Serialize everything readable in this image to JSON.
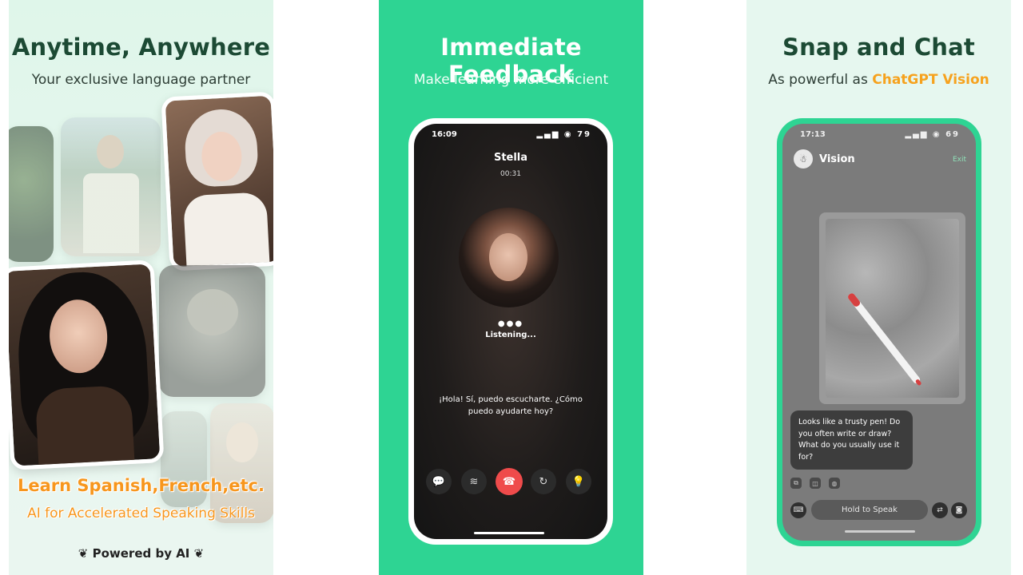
{
  "panel1": {
    "title": "Anytime, Anywhere",
    "subtitle": "Your exclusive language partner",
    "promo_line1": "Learn Spanish,French,etc.",
    "promo_line2": "AI for Accelerated Speaking Skills",
    "powered": "Powered by AI",
    "laurel_left": "❦",
    "laurel_right": "❦"
  },
  "panel2": {
    "title": "Immediate Feedback",
    "subtitle": "Make learning more efficient",
    "status": {
      "time": "16:09",
      "icons": "▂▄▆ ◉ 79"
    },
    "call": {
      "name": "Stella",
      "duration": "00:31",
      "dots": "●●●",
      "state": "Listening...",
      "caption": "¡Hola! Sí, puedo escucharte. ¿Cómo puedo ayudarte hoy?"
    },
    "controls": [
      {
        "name": "chat-icon",
        "glyph": "💬"
      },
      {
        "name": "mute-icon",
        "glyph": "≋"
      },
      {
        "name": "hangup-icon",
        "glyph": "☎"
      },
      {
        "name": "speed-icon",
        "glyph": "↻"
      },
      {
        "name": "hint-icon",
        "glyph": "💡"
      }
    ]
  },
  "panel3": {
    "title": "Snap and Chat",
    "subtitle_prefix": "As powerful as ",
    "subtitle_highlight": "ChatGPT Vision",
    "status": {
      "time": "17:13",
      "icons": "▂▄▆ ◉ 69"
    },
    "header": {
      "avatar": "☃",
      "title": "Vision",
      "exit": "Exit"
    },
    "reply": "Looks like a trusty pen! Do you often write or draw? What do you usually use it for?",
    "reply_icons": [
      "⧉",
      "◫",
      "◍"
    ],
    "input": {
      "keyboard": "⌨",
      "hold": "Hold to Speak",
      "switch": "⇄",
      "camera": "◙"
    }
  },
  "colors": {
    "green": "#2ed493",
    "accent_orange": "#f6a21e",
    "dark_title": "#1c4a34",
    "hangup_red": "#ef4b4b"
  }
}
